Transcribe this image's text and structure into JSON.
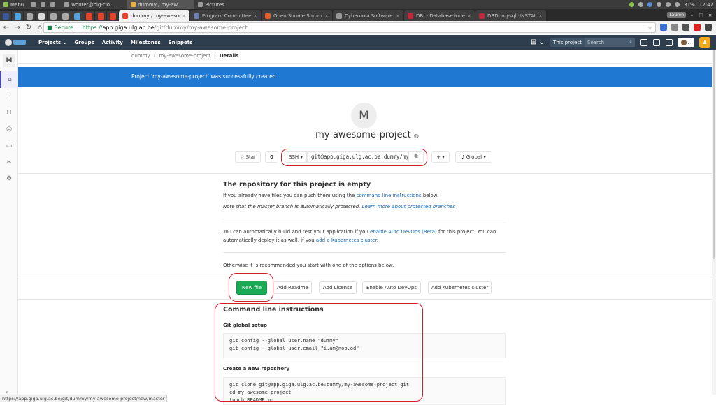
{
  "taskbar": {
    "menu_label": "Menu",
    "items": [
      {
        "label": "wouter@big-clo..."
      },
      {
        "label": "dummy / my-aw..."
      },
      {
        "label": "Pictures"
      }
    ],
    "battery": "31%",
    "time": "12:47"
  },
  "tabs": [
    {
      "title": "dummy / my-awesome-",
      "color": "#e24329",
      "active": true
    },
    {
      "title": "Program Committee -",
      "color": "#6a7fb0",
      "active": false
    },
    {
      "title": "Open Source Summit E",
      "color": "#e25b25",
      "active": false
    },
    {
      "title": "Cybernoia Software -",
      "color": "#9a9a9a",
      "active": false
    },
    {
      "title": "DBI - Database indepe",
      "color": "#c0283b",
      "active": false
    },
    {
      "title": "DBD::mysql::INSTALL -",
      "color": "#c0283b",
      "active": false
    }
  ],
  "browser": {
    "user_chip": "Lauren",
    "secure_label": "Secure",
    "url_scheme": "https://",
    "url_host": "app.giga.ulg.ac.be",
    "url_path": "/git/dummy/my-awesome-project"
  },
  "gitlab_nav": {
    "projects": "Projects",
    "groups": "Groups",
    "activity": "Activity",
    "milestones": "Milestones",
    "snippets": "Snippets",
    "this_project": "This project",
    "search_placeholder": "Search"
  },
  "sidebar": {
    "avatar_letter": "M"
  },
  "breadcrumb": {
    "group": "dummy",
    "project": "my-awesome-project",
    "current": "Details"
  },
  "flash": {
    "message": "Project 'my-awesome-project' was successfully created."
  },
  "project": {
    "avatar_letter": "M",
    "name": "my-awesome-project",
    "star_label": "Star",
    "star_count": "0",
    "protocol": "SSH",
    "clone_url": "git@app.giga.ulg.ac.be:dummy/my-awesome-project.git",
    "notification_level": "Global"
  },
  "empty_repo": {
    "title": "The repository for this project is empty",
    "line1_pre": "If you already have files you can push them using the",
    "line1_link": "command line instructions",
    "line1_post": "below.",
    "line2_pre": "Note that the master branch is automatically protected.",
    "line2_link": "Learn more about protected branches",
    "devops_pre": "You can automatically build and test your application if you",
    "devops_link": "enable Auto DevOps (Beta)",
    "devops_post": "for this project. You can",
    "devops2_pre": "automatically deploy it as well, if you",
    "devops2_link": "add a Kubernetes cluster",
    "devops2_post": ".",
    "options_text": "Otherwise it is recommended you start with one of the options below."
  },
  "options": {
    "new_file": "New file",
    "add_readme": "Add Readme",
    "add_license": "Add License",
    "enable_devops": "Enable Auto DevOps",
    "add_k8s": "Add Kubernetes cluster"
  },
  "cli": {
    "title": "Command line instructions",
    "global_setup": "Git global setup",
    "global_code": "git config --global user.name \"dummy\"\ngit config --global user.email \"i.am@nob.od\"",
    "new_repo": "Create a new repository",
    "new_repo_code": "git clone git@app.giga.ulg.ac.be:dummy/my-awesome-project.git\ncd my-awesome-project\ntouch README.md"
  },
  "statusbar": {
    "url": "https://app.giga.ulg.ac.be/git/dummy/my-awesome-project/new/master"
  },
  "colors": {
    "accent": "#1f78d1",
    "success": "#1aaa55",
    "nav": "#2e3e4e",
    "annotation": "#d0202a"
  }
}
